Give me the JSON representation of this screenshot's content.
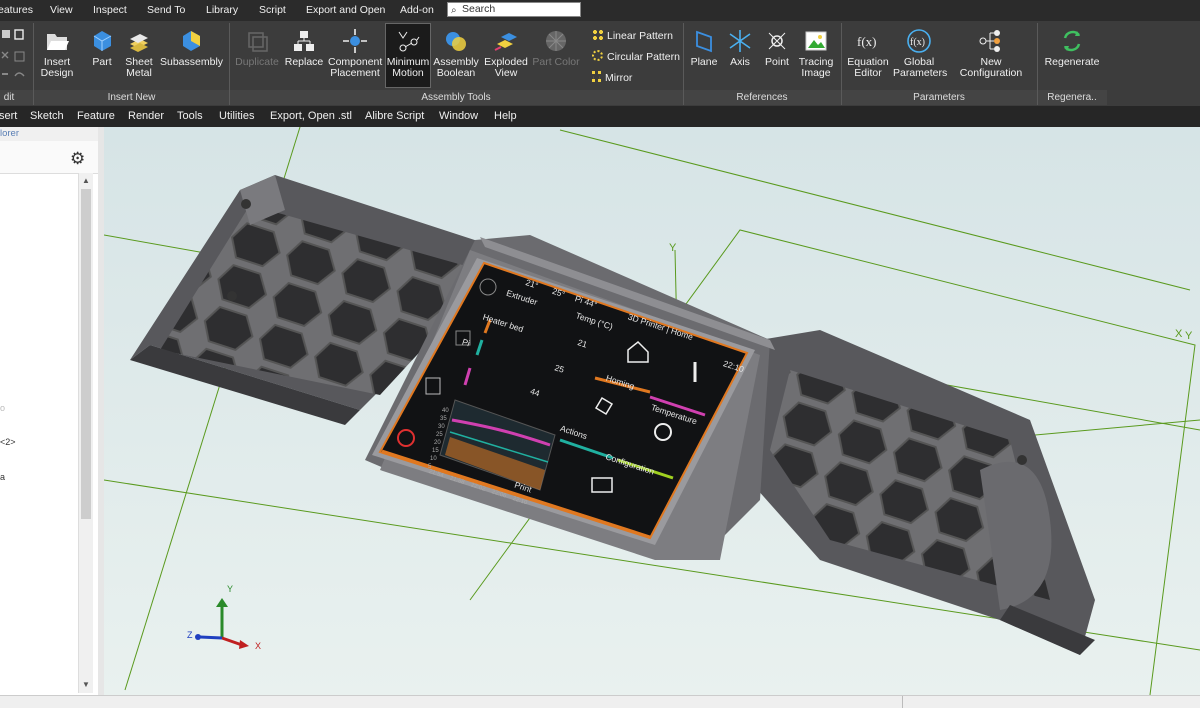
{
  "tabs": [
    "eatures",
    "View",
    "Inspect",
    "Send To",
    "Library",
    "Script",
    "Export and Open",
    "Add-on"
  ],
  "search": {
    "placeholder": "Search"
  },
  "ribbon": {
    "edit_group": "dit",
    "insert_design": "Insert\nDesign",
    "part": "Part",
    "sheet_metal": "Sheet\nMetal",
    "subassembly": "Subassembly",
    "insert_new_group": "Insert New",
    "duplicate": "Duplicate",
    "replace": "Replace",
    "component_placement": "Component\nPlacement",
    "minimum_motion": "Minimum\nMotion",
    "assembly_boolean": "Assembly\nBoolean",
    "exploded_view": "Exploded\nView",
    "part_color": "Part Color",
    "linear_pattern": "Linear Pattern",
    "circular_pattern": "Circular Pattern",
    "mirror": "Mirror",
    "assembly_tools_group": "Assembly Tools",
    "plane": "Plane",
    "axis": "Axis",
    "point": "Point",
    "tracing_image": "Tracing\nImage",
    "references_group": "References",
    "equation_editor": "Equation\nEditor",
    "global_parameters": "Global\nParameters",
    "new_configuration": "New Configuration",
    "parameters_group": "Parameters",
    "regenerate": "Regenerate",
    "regenerate_group": "Regenera.."
  },
  "menu": [
    "sert",
    "Sketch",
    "Feature",
    "Render",
    "Tools",
    "Utilities",
    "Export, Open .stl",
    "Alibre Script",
    "Window",
    "Help"
  ],
  "panel": {
    "title": "lorer",
    "tree": [
      "o",
      "<2>",
      "a"
    ]
  },
  "screen": {
    "status": [
      "21°",
      "25°",
      "Pi 44°"
    ],
    "title": "3D Printer | Home",
    "time": "22:10",
    "col_head": "Temp (°C)",
    "rows": [
      {
        "label": "Extruder",
        "value": "21"
      },
      {
        "label": "Heater bed",
        "value": "25"
      },
      {
        "label": "Pi",
        "value": "44"
      }
    ],
    "tiles": [
      "Homing",
      "Temperature",
      "Actions",
      "Configuration",
      "Print"
    ],
    "chart_y": [
      "40",
      "35",
      "30",
      "25",
      "20",
      "15",
      "10",
      "5"
    ],
    "chart_x": [
      "21:54",
      "21:58",
      "22:02",
      "22:06",
      "22:10"
    ]
  },
  "triad": {
    "x": "X",
    "y": "Y",
    "z": "Z"
  },
  "plane_labels": [
    "Y",
    "X",
    "Y"
  ]
}
